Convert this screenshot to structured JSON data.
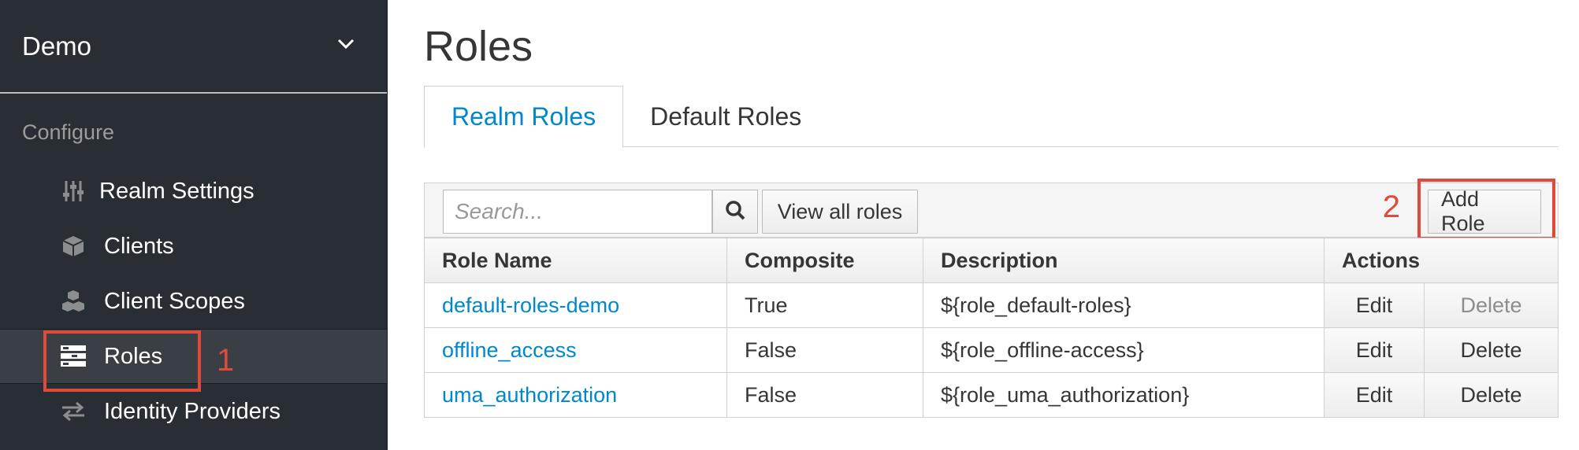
{
  "sidebar": {
    "realm": "Demo",
    "section_title": "Configure",
    "items": [
      {
        "label": "Realm Settings",
        "icon": "sliders-icon"
      },
      {
        "label": "Clients",
        "icon": "cube-icon"
      },
      {
        "label": "Client Scopes",
        "icon": "cubes-icon"
      },
      {
        "label": "Roles",
        "icon": "list-icon",
        "active": true
      },
      {
        "label": "Identity Providers",
        "icon": "exchange-icon"
      }
    ]
  },
  "main": {
    "title": "Roles",
    "tabs": [
      {
        "label": "Realm Roles",
        "active": true
      },
      {
        "label": "Default Roles",
        "active": false
      }
    ],
    "toolbar": {
      "search_placeholder": "Search...",
      "view_all_label": "View all roles",
      "add_role_label": "Add Role"
    },
    "annotations": {
      "one": "1",
      "two": "2"
    },
    "table": {
      "headers": [
        "Role Name",
        "Composite",
        "Description",
        "Actions"
      ],
      "rows": [
        {
          "name": "default-roles-demo",
          "composite": "True",
          "description": "${role_default-roles}",
          "edit": "Edit",
          "delete": "Delete",
          "delete_disabled": true
        },
        {
          "name": "offline_access",
          "composite": "False",
          "description": "${role_offline-access}",
          "edit": "Edit",
          "delete": "Delete",
          "delete_disabled": false
        },
        {
          "name": "uma_authorization",
          "composite": "False",
          "description": "${role_uma_authorization}",
          "edit": "Edit",
          "delete": "Delete",
          "delete_disabled": false
        }
      ]
    }
  },
  "colors": {
    "sidebar_bg": "#292e34",
    "link": "#0088ce",
    "annotation": "#e04a3a"
  }
}
